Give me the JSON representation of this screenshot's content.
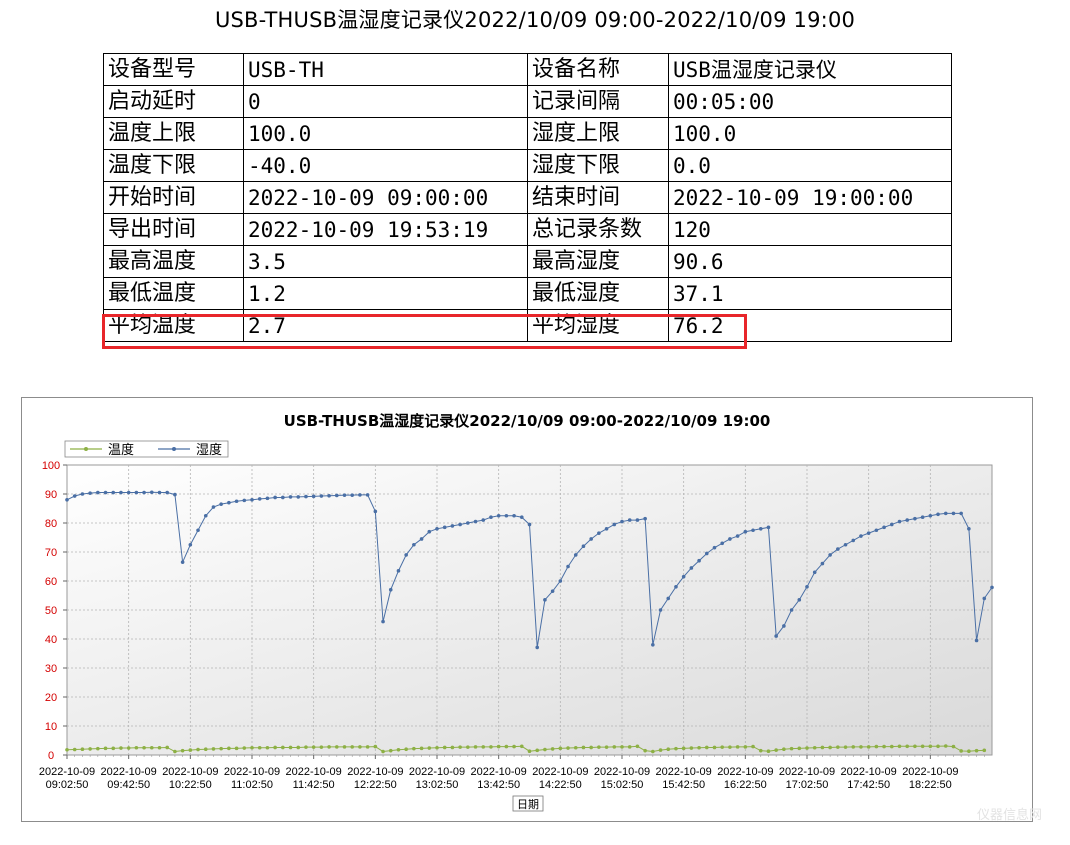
{
  "report": {
    "title": "USB-THUSB温湿度记录仪2022/10/09 09:00-2022/10/09 19:00"
  },
  "info_table": {
    "rows": [
      [
        "设备型号",
        "USB-TH",
        "设备名称",
        "USB温湿度记录仪"
      ],
      [
        "启动延时",
        "0",
        "记录间隔",
        "00:05:00"
      ],
      [
        "温度上限",
        "100.0",
        "湿度上限",
        "100.0"
      ],
      [
        "温度下限",
        "-40.0",
        "湿度下限",
        "0.0"
      ],
      [
        "开始时间",
        "2022-10-09 09:00:00",
        "结束时间",
        "2022-10-09 19:00:00"
      ],
      [
        "导出时间",
        "2022-10-09 19:53:19",
        "总记录条数",
        "120"
      ],
      [
        "最高温度",
        "3.5",
        "最高湿度",
        "90.6"
      ],
      [
        "最低温度",
        "1.2",
        "最低湿度",
        "37.1"
      ],
      [
        "平均温度",
        "2.7",
        "平均湿度",
        "76.2"
      ]
    ],
    "highlight_color": "#e8262a"
  },
  "watermark": "仪器信息网",
  "chart_data": {
    "type": "line",
    "title": "USB-THUSB温湿度记录仪2022/10/09 09:00-2022/10/09 19:00",
    "xlabel": "日期",
    "ylabel": "",
    "ylim": [
      0,
      100
    ],
    "y_ticks": [
      0,
      10,
      20,
      30,
      40,
      50,
      60,
      70,
      80,
      90,
      100
    ],
    "grid": true,
    "legend": "top-left",
    "x_tick_labels": [
      [
        "2022-10-09",
        "09:02:50"
      ],
      [
        "2022-10-09",
        "09:42:50"
      ],
      [
        "2022-10-09",
        "10:22:50"
      ],
      [
        "2022-10-09",
        "11:02:50"
      ],
      [
        "2022-10-09",
        "11:42:50"
      ],
      [
        "2022-10-09",
        "12:22:50"
      ],
      [
        "2022-10-09",
        "13:02:50"
      ],
      [
        "2022-10-09",
        "13:42:50"
      ],
      [
        "2022-10-09",
        "14:22:50"
      ],
      [
        "2022-10-09",
        "15:02:50"
      ],
      [
        "2022-10-09",
        "15:42:50"
      ],
      [
        "2022-10-09",
        "16:22:50"
      ],
      [
        "2022-10-09",
        "17:02:50"
      ],
      [
        "2022-10-09",
        "17:42:50"
      ],
      [
        "2022-10-09",
        "18:22:50"
      ]
    ],
    "series": [
      {
        "name": "温度",
        "color": "#8db045",
        "values": [
          1.8,
          1.9,
          2.0,
          2.1,
          2.2,
          2.3,
          2.3,
          2.4,
          2.4,
          2.5,
          2.5,
          2.5,
          2.5,
          2.6,
          1.2,
          1.5,
          1.7,
          1.9,
          2.0,
          2.1,
          2.2,
          2.3,
          2.3,
          2.4,
          2.5,
          2.5,
          2.5,
          2.6,
          2.6,
          2.6,
          2.6,
          2.7,
          2.7,
          2.7,
          2.8,
          2.8,
          2.8,
          2.8,
          2.8,
          2.8,
          2.9,
          1.2,
          1.5,
          1.8,
          2.0,
          2.2,
          2.3,
          2.4,
          2.5,
          2.6,
          2.6,
          2.7,
          2.7,
          2.8,
          2.8,
          2.8,
          2.9,
          2.9,
          2.9,
          3.0,
          1.3,
          1.6,
          1.9,
          2.1,
          2.3,
          2.4,
          2.5,
          2.6,
          2.6,
          2.7,
          2.7,
          2.8,
          2.8,
          2.8,
          3.0,
          1.5,
          1.2,
          1.7,
          2.0,
          2.2,
          2.3,
          2.4,
          2.5,
          2.6,
          2.6,
          2.7,
          2.7,
          2.8,
          2.8,
          2.9,
          1.5,
          1.3,
          1.7,
          2.0,
          2.2,
          2.3,
          2.4,
          2.5,
          2.6,
          2.6,
          2.7,
          2.7,
          2.8,
          2.8,
          2.8,
          2.9,
          2.9,
          2.9,
          3.0,
          3.0,
          3.0,
          3.0,
          3.0,
          3.0,
          3.1,
          2.9,
          1.4,
          1.3,
          1.5,
          1.6
        ]
      },
      {
        "name": "湿度",
        "color": "#4a6fa5",
        "values": [
          88.0,
          89.3,
          90.0,
          90.3,
          90.5,
          90.5,
          90.5,
          90.5,
          90.5,
          90.5,
          90.5,
          90.6,
          90.5,
          90.5,
          89.8,
          66.5,
          72.5,
          77.5,
          82.5,
          85.5,
          86.5,
          87.0,
          87.5,
          87.8,
          88.0,
          88.3,
          88.5,
          88.8,
          88.8,
          89.0,
          89.0,
          89.1,
          89.2,
          89.3,
          89.4,
          89.5,
          89.6,
          89.6,
          89.7,
          89.7,
          84.0,
          46.0,
          57.0,
          63.5,
          69.0,
          72.5,
          74.5,
          77.0,
          78.0,
          78.5,
          79.0,
          79.5,
          80.0,
          80.5,
          81.0,
          82.0,
          82.5,
          82.5,
          82.5,
          82.0,
          79.5,
          37.1,
          53.5,
          56.5,
          60.0,
          65.0,
          69.0,
          72.0,
          74.5,
          76.5,
          78.0,
          79.5,
          80.5,
          81.0,
          81.0,
          81.5,
          38.0,
          50.0,
          54.0,
          58.0,
          61.5,
          64.5,
          67.0,
          69.5,
          71.5,
          73.0,
          74.5,
          75.5,
          77.0,
          77.5,
          78.0,
          78.5,
          41.0,
          44.5,
          50.0,
          53.5,
          58.0,
          63.0,
          66.0,
          69.0,
          71.0,
          72.5,
          74.0,
          75.5,
          76.5,
          77.5,
          78.5,
          79.5,
          80.5,
          81.0,
          81.5,
          82.0,
          82.5,
          83.0,
          83.3,
          83.3,
          83.3,
          78.0,
          39.5,
          54.0,
          57.8
        ]
      }
    ]
  }
}
